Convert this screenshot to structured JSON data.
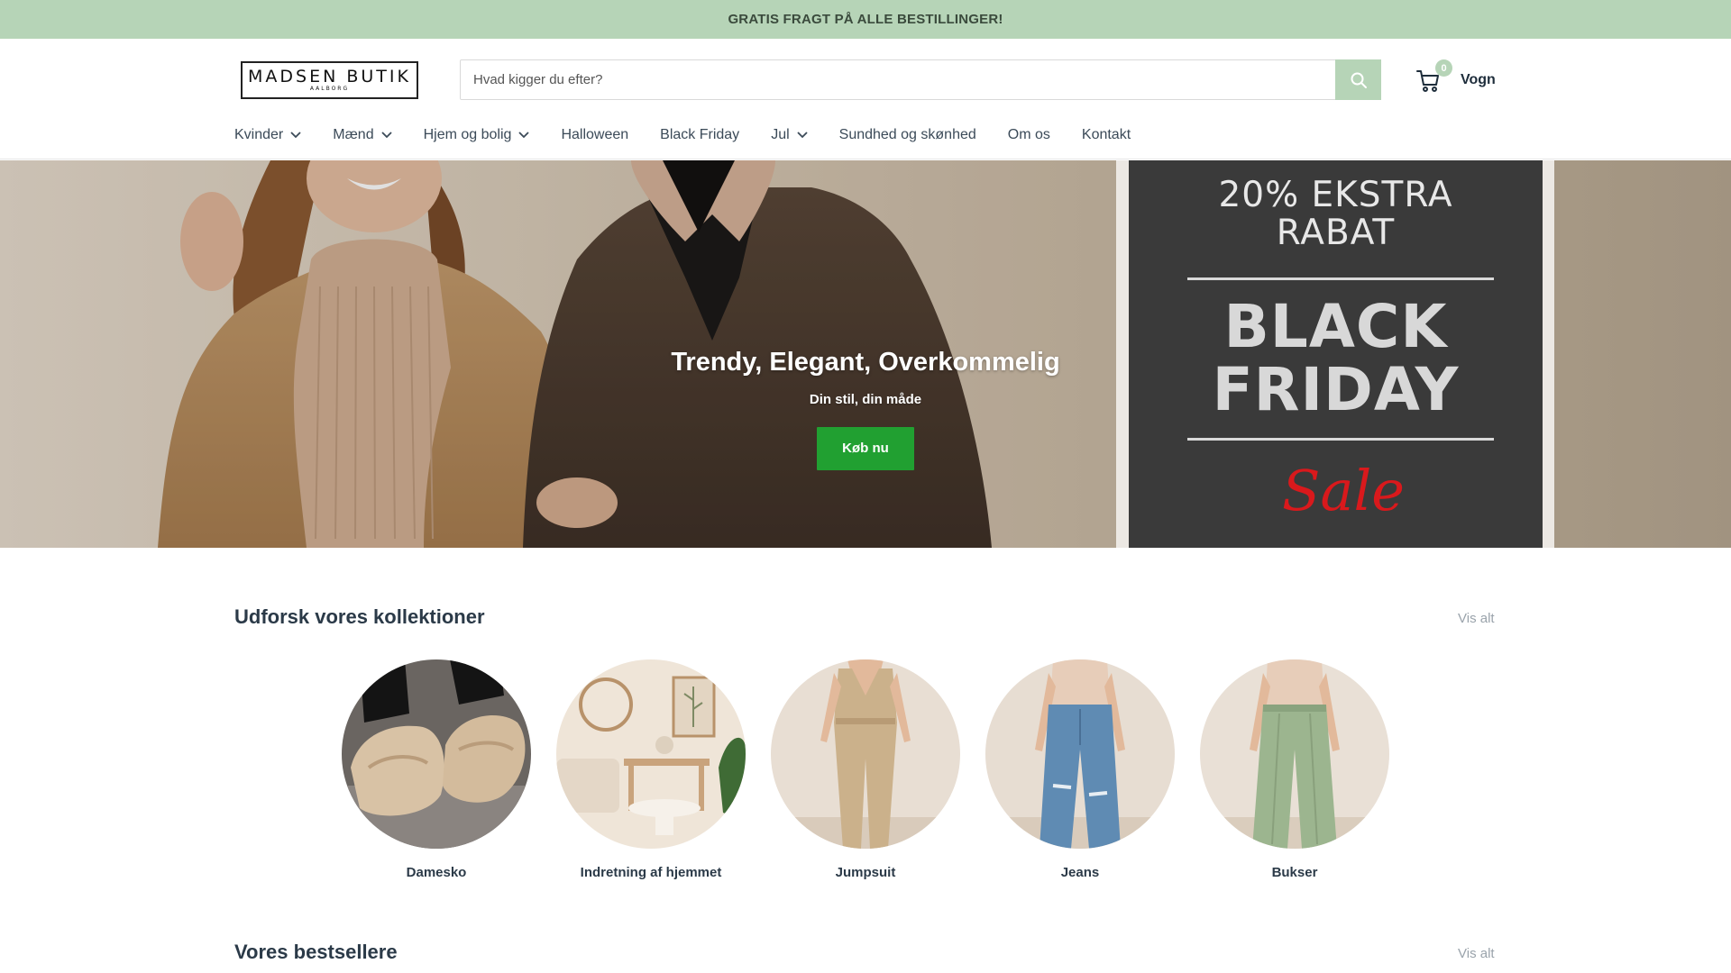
{
  "announcement": {
    "text": "GRATIS FRAGT PÅ ALLE BESTILLINGER!"
  },
  "header": {
    "logo_main": "MADSEN BUTIK",
    "logo_sub": "AALBORG",
    "search_placeholder": "Hvad kigger du efter?",
    "cart_count": "0",
    "cart_label": "Vogn"
  },
  "nav": {
    "items": [
      {
        "label": "Kvinder",
        "dropdown": true
      },
      {
        "label": "Mænd",
        "dropdown": true
      },
      {
        "label": "Hjem og bolig",
        "dropdown": true
      },
      {
        "label": "Halloween",
        "dropdown": false
      },
      {
        "label": "Black Friday",
        "dropdown": false
      },
      {
        "label": "Jul",
        "dropdown": true
      },
      {
        "label": "Sundhed og skønhed",
        "dropdown": false
      },
      {
        "label": "Om os",
        "dropdown": false
      },
      {
        "label": "Kontakt",
        "dropdown": false
      }
    ]
  },
  "hero": {
    "title": "Trendy, Elegant, Overkommelig",
    "subtitle": "Din stil, din måde",
    "button": "Køb nu"
  },
  "promo": {
    "line1": "20% EKSTRA",
    "line2": "RABAT",
    "line3": "BLACK",
    "line4": "FRIDAY",
    "script": "Sale"
  },
  "collections": {
    "title": "Udforsk vores kollektioner",
    "view_all": "Vis alt",
    "items": [
      {
        "label": "Damesko"
      },
      {
        "label": "Indretning af hjemmet"
      },
      {
        "label": "Jumpsuit"
      },
      {
        "label": "Jeans"
      },
      {
        "label": "Bukser"
      }
    ]
  },
  "bestsellers": {
    "title": "Vores bestsellere",
    "view_all": "Vis alt"
  },
  "colors": {
    "accent_green": "#b6d4b7",
    "button_green": "#21a031",
    "text_dark": "#1e2d3b"
  },
  "icons": [
    "search-icon",
    "cart-icon",
    "chevron-down-icon"
  ]
}
